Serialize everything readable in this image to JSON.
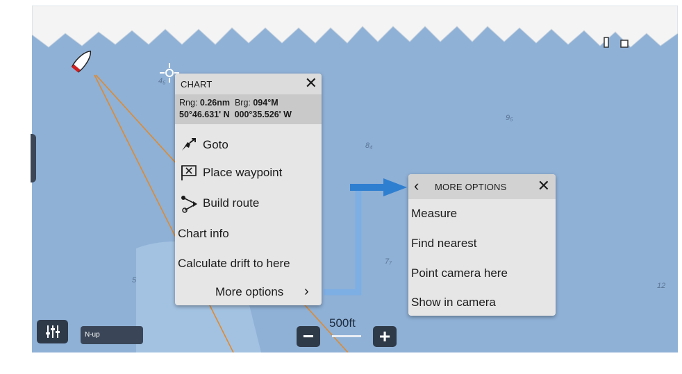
{
  "chart_menu": {
    "title": "CHART",
    "close_icon": "close-icon",
    "range_label": "Rng:",
    "range_value": "0.26nm",
    "bearing_label": "Brg:",
    "bearing_value": "094°M",
    "latitude": "50°46.631' N",
    "longitude": "000°35.526' W",
    "items": [
      {
        "label": "Goto",
        "icon": "goto-icon"
      },
      {
        "label": "Place waypoint",
        "icon": "waypoint-flag-icon"
      },
      {
        "label": "Build route",
        "icon": "route-icon"
      },
      {
        "label": "Chart info"
      },
      {
        "label": "Calculate drift to here"
      },
      {
        "label": "More options",
        "icon": "chevron-right-icon"
      }
    ]
  },
  "more_menu": {
    "title": "MORE OPTIONS",
    "back_icon": "chevron-left-icon",
    "close_icon": "close-icon",
    "items": [
      "Measure",
      "Find nearest",
      "Point camera here",
      "Show in camera"
    ]
  },
  "controls": {
    "orientation_label": "N-up",
    "scale_label": "500ft",
    "settings_icon": "sliders-icon",
    "zoom_out_icon": "minus-icon",
    "zoom_in_icon": "plus-icon"
  },
  "depths": [
    "4₅",
    "9₅",
    "8₄",
    "7₇",
    "5",
    "12"
  ],
  "colors": {
    "sea": "#8fb1d6",
    "land": "#f4f4f4",
    "menu_bg": "#e6e6e6",
    "control_bg": "#2f3a49",
    "arrow": "#3a86d4",
    "course_line": "#e08a2e"
  }
}
